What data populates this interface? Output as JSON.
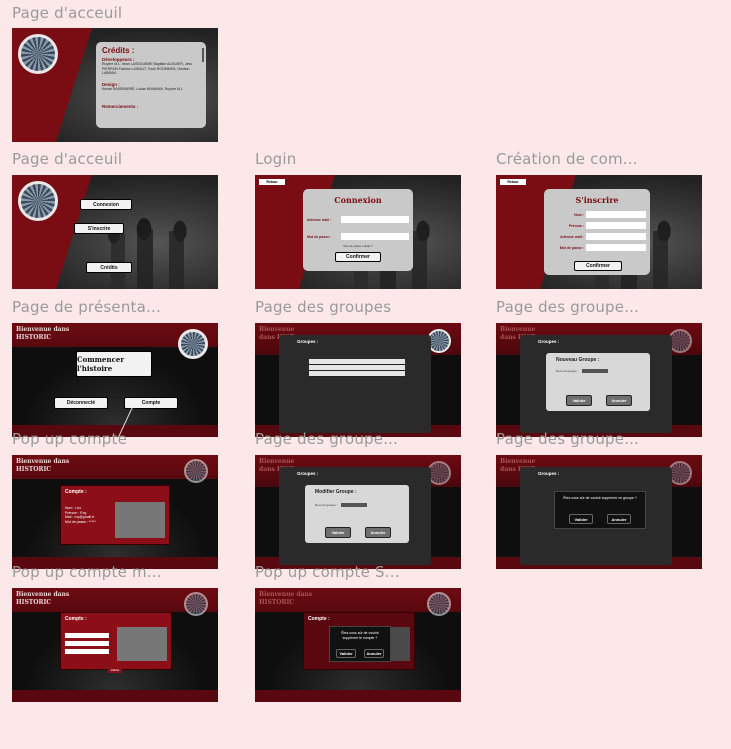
{
  "frames": {
    "f1": {
      "label": "Page d'acceuil",
      "credits_title": "Crédits :",
      "section1_title": "Développeurs :",
      "section1_text": "Ruyère M.L, Ithan LASSOUEME Baptiste AUGUIER, Jess PIERRON Fabrice LAISAUT, Touki ROOMMEN, Gestion LABRAN",
      "section2_title": "Design :",
      "section2_text": "Kevan RASEBARRÉ, Lukas MIVAMAN, Ruyère M.L",
      "section3_title": "Remerciements :"
    },
    "f2": {
      "label": "Page d'acceuil",
      "btn_connect": "Connexion",
      "btn_signup": "S'inscrire",
      "btn_credits": "Crédits"
    },
    "f3": {
      "label": "Login",
      "back": "Retour",
      "title": "Connexion",
      "field1_label": "Adresse mail :",
      "field2_label": "Mot de passe :",
      "forgot": "Mot de passe oublié ?",
      "submit": "Confirmer"
    },
    "f4": {
      "label": "Création de com...",
      "back": "Retour",
      "title": "S'inscrire",
      "f_nom": "Nom :",
      "f_prenom": "Prénom :",
      "f_mail": "Adresse mail :",
      "f_mdp": "Mot de passe :",
      "submit": "Confirmer"
    },
    "f5": {
      "label": "Page de présenta...",
      "header": "Bienvenue dans HISTORIC",
      "main_btn": "Commencer l'histoire",
      "btn_left": "Déconnecté",
      "btn_right": "Compte"
    },
    "f6": {
      "label": "Page des groupes",
      "header": "Bienvenue dans HIST",
      "section": "Groupes :"
    },
    "f7": {
      "label": "Page des groupe...",
      "header": "Bienvenue dans HIST",
      "section": "Groupes :",
      "modal_title": "Nouveau Groupe :",
      "field": "Nom du groupe :",
      "btn1": "Valider",
      "btn2": "Annuler"
    },
    "f8": {
      "label": "Pop up compte",
      "header": "Bienvenue dans HISTORIC",
      "popup_title": "Compte :",
      "lines": "Nom : Leo\nPrénom : Ruy\nMail : ruy@gmail.fr\nMot de passe : *****"
    },
    "f9": {
      "label": "Page des groupe...",
      "header": "Bienvenue dans HIST",
      "section": "Groupes :",
      "modal_title": "Modifier Groupe :",
      "field": "Nom du groupe :",
      "btn1": "Valider",
      "btn2": "Annuler"
    },
    "f10": {
      "label": "Page des groupe...",
      "header": "Bienvenue dans HIST",
      "section": "Groupes :",
      "confirm": "Êtes-vous sûr de vouloir supprimer ce groupe ?",
      "btn1": "Valider",
      "btn2": "Annuler"
    },
    "f11": {
      "label": "Pop up compte m...",
      "header": "Bienvenue dans HISTORIC",
      "popup_title": "Compte :",
      "confirm_btn": "Valider"
    },
    "f12": {
      "label": "Pop up compte S...",
      "header": "Bienvenue dans HISTORIC",
      "popup_title": "Compte :",
      "confirm": "Êtes-vous sûr de vouloir supprimer le compte ?",
      "btn1": "Valider",
      "btn2": "Annuler"
    }
  },
  "colors": {
    "background": "#fce8e8",
    "brand_red": "#7a0c14",
    "label_grey": "#9a9a9a"
  }
}
